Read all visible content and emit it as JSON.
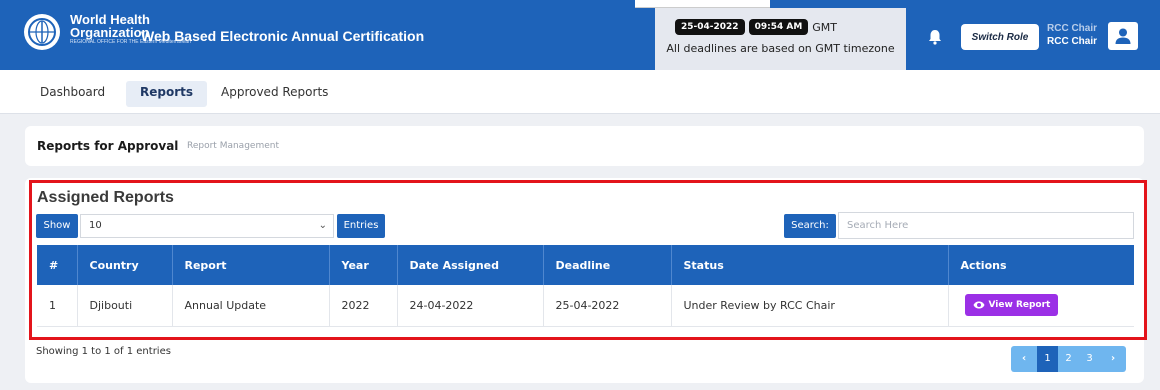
{
  "header": {
    "org_line1": "World Health",
    "org_line2": "Organization",
    "org_line3": "REGIONAL OFFICE FOR THE Eastern Mediterranean",
    "app_title": "Web Based Electronic Annual Certification",
    "date": "25-04-2022",
    "time": "09:54 AM",
    "timezone": "GMT",
    "timezone_note": "All deadlines are based on GMT timezone",
    "switch_role_label": "Switch Role",
    "role_line1": "RCC Chair",
    "role_line2": "RCC Chair"
  },
  "nav": {
    "items": [
      {
        "label": "Dashboard",
        "active": false
      },
      {
        "label": "Reports",
        "active": true
      },
      {
        "label": "Approved Reports",
        "active": false
      }
    ]
  },
  "breadcrumb": {
    "title": "Reports for Approval",
    "subtitle": "Report Management"
  },
  "reports": {
    "section_title": "Assigned Reports",
    "show_label": "Show",
    "entries_value": "10",
    "entries_label": "Entries",
    "search_label": "Search:",
    "search_placeholder": "Search Here",
    "columns": [
      "#",
      "Country",
      "Report",
      "Year",
      "Date Assigned",
      "Deadline",
      "Status",
      "Actions"
    ],
    "rows": [
      {
        "num": "1",
        "country": "Djibouti",
        "report": "Annual Update",
        "year": "2022",
        "date_assigned": "24-04-2022",
        "deadline": "25-04-2022",
        "status": "Under Review by RCC Chair",
        "action_label": "View Report"
      }
    ],
    "showing_text": "Showing 1 to 1 of 1 entries",
    "pagination": {
      "prev": "‹",
      "pages": [
        "1",
        "2",
        "3"
      ],
      "active_page": "1",
      "next": "›"
    }
  },
  "colors": {
    "primary": "#1e63b9",
    "action": "#9b30e6",
    "highlight": "#e3141b",
    "pager": "#6fb6ef"
  },
  "icons": {
    "logo": "who-emblem-icon",
    "bell": "bell-icon",
    "user": "user-icon",
    "eye": "eye-icon",
    "select": "chevron-down-icon"
  }
}
